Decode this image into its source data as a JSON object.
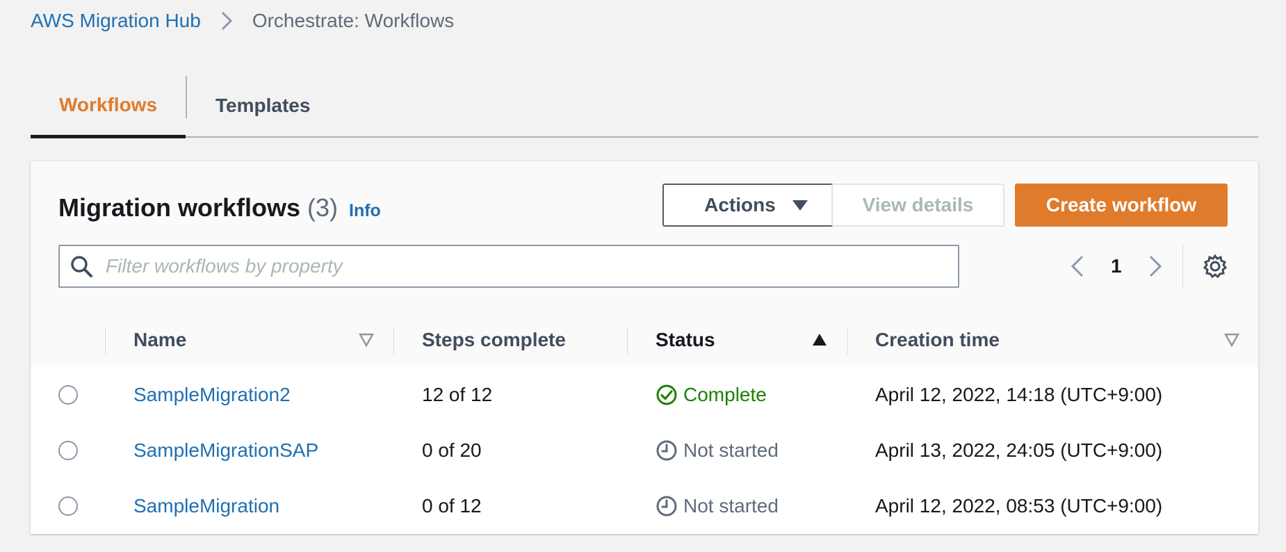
{
  "breadcrumb": {
    "root": "AWS Migration Hub",
    "current": "Orchestrate: Workflows"
  },
  "tabs": [
    {
      "label": "Workflows",
      "active": true
    },
    {
      "label": "Templates",
      "active": false
    }
  ],
  "header": {
    "title": "Migration workflows",
    "count": "(3)",
    "info": "Info"
  },
  "buttons": {
    "actions": "Actions",
    "view_details": "View details",
    "create": "Create workflow"
  },
  "filter": {
    "placeholder": "Filter workflows by property"
  },
  "pagination": {
    "page": "1"
  },
  "table": {
    "columns": [
      "Name",
      "Steps complete",
      "Status",
      "Creation time"
    ],
    "sorted_column": "Status",
    "sort_direction": "ascending",
    "rows": [
      {
        "name": "SampleMigration2",
        "steps": "12 of 12",
        "status": "Complete",
        "status_type": "success",
        "created": "April 12, 2022, 14:18 (UTC+9:00)"
      },
      {
        "name": "SampleMigrationSAP",
        "steps": "0 of 20",
        "status": "Not started",
        "status_type": "pending",
        "created": "April 13, 2022, 24:05 (UTC+9:00)"
      },
      {
        "name": "SampleMigration",
        "steps": "0 of 12",
        "status": "Not started",
        "status_type": "pending",
        "created": "April 12, 2022, 08:53 (UTC+9:00)"
      }
    ]
  },
  "colors": {
    "accent": "#e07b2c",
    "link": "#1f6fb2",
    "success": "#1d8102",
    "muted": "#5f6b7a"
  },
  "icons": [
    "chevron-right-icon",
    "search-icon",
    "caret-down-icon",
    "chevron-left-icon",
    "gear-icon",
    "sort-icon",
    "check-circle-icon",
    "clock-icon"
  ]
}
